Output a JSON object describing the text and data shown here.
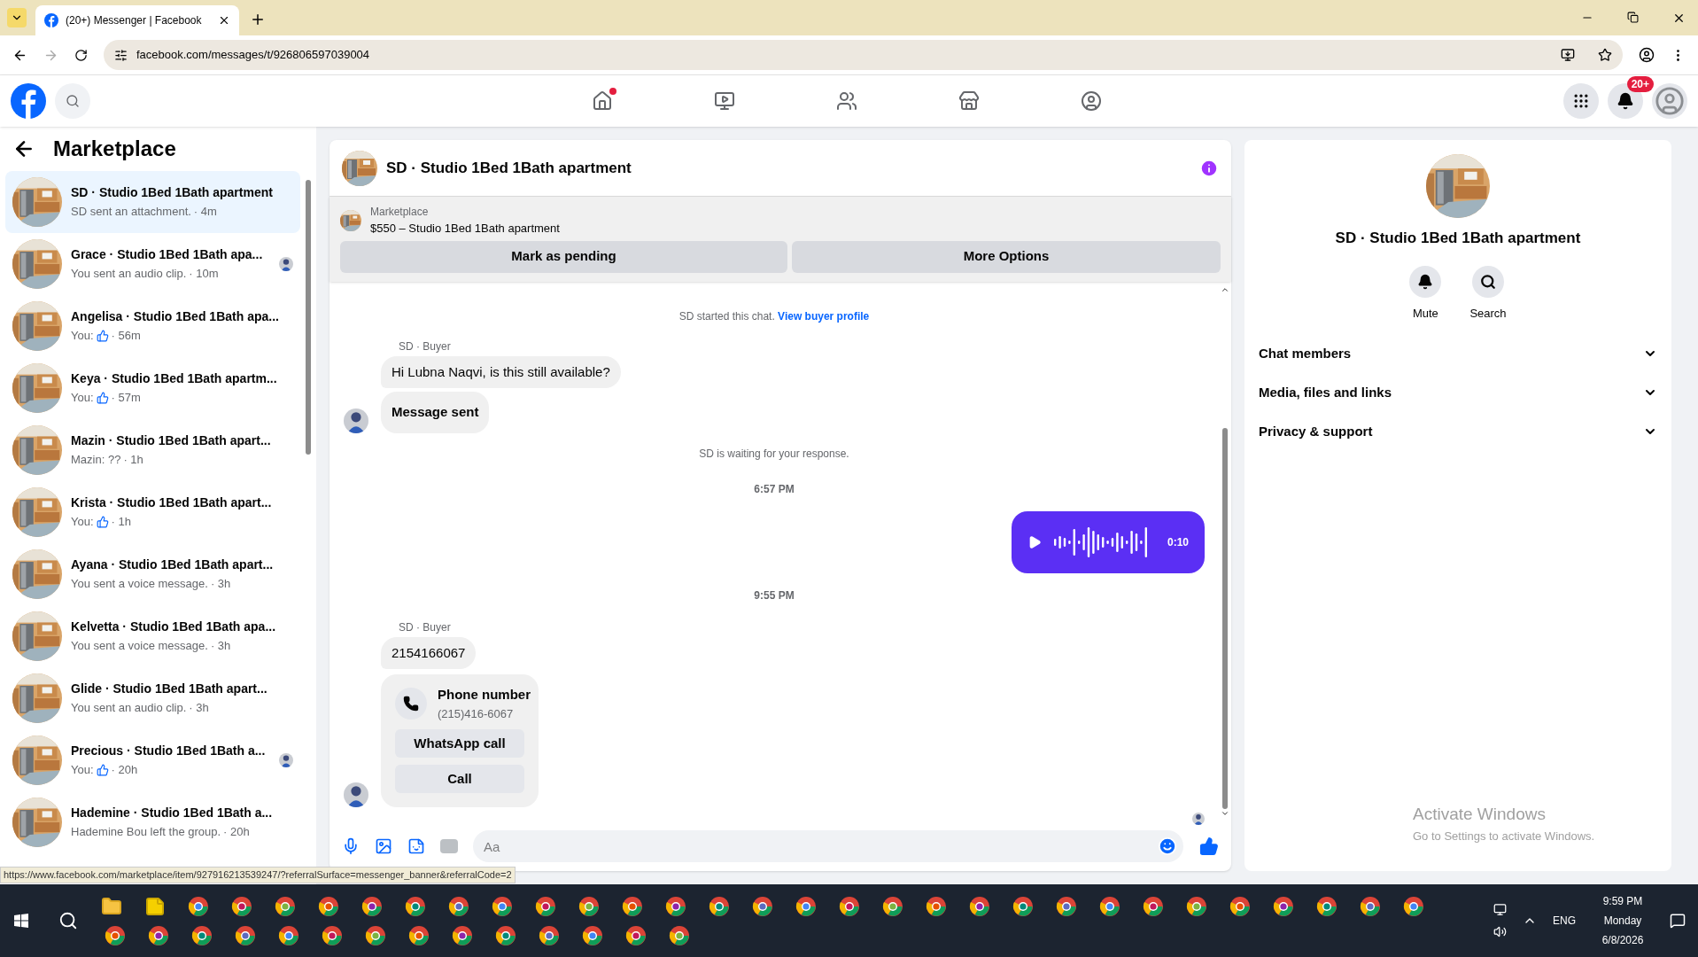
{
  "browser": {
    "tab_title": "(20+) Messenger | Facebook",
    "url": "facebook.com/messages/t/926806597039004"
  },
  "header": {
    "nav": [
      {
        "kind": "home",
        "selected": false,
        "notify": true
      },
      {
        "kind": "video",
        "selected": false,
        "notify": false
      },
      {
        "kind": "friends",
        "selected": false,
        "notify": false
      },
      {
        "kind": "marketplace",
        "selected": false,
        "notify": false
      },
      {
        "kind": "groups",
        "selected": false,
        "notify": false
      }
    ],
    "notification_count": "20+"
  },
  "sidebar": {
    "title": "Marketplace",
    "conversations": [
      {
        "name": "SD · Studio 1Bed 1Bath apartment",
        "preview": "SD sent an attachment.",
        "thumb": false,
        "time": "· 4m",
        "selected": true,
        "seen_avatar": false
      },
      {
        "name": "Grace · Studio 1Bed 1Bath apa...",
        "preview": "You sent an audio clip.",
        "thumb": false,
        "time": "· 10m",
        "selected": false,
        "seen_avatar": true
      },
      {
        "name": "Angelisa · Studio 1Bed 1Bath apa...",
        "preview": "You:",
        "thumb": true,
        "time": "· 56m",
        "selected": false,
        "seen_avatar": false
      },
      {
        "name": "Keya · Studio 1Bed 1Bath apartm...",
        "preview": "You:",
        "thumb": true,
        "time": "· 57m",
        "selected": false,
        "seen_avatar": false
      },
      {
        "name": "Mazin · Studio 1Bed 1Bath apart...",
        "preview": "Mazin: ??",
        "thumb": false,
        "time": "· 1h",
        "selected": false,
        "seen_avatar": false
      },
      {
        "name": "Krista · Studio 1Bed 1Bath apart...",
        "preview": "You:",
        "thumb": true,
        "time": "· 1h",
        "selected": false,
        "seen_avatar": false
      },
      {
        "name": "Ayana · Studio 1Bed 1Bath apart...",
        "preview": "You sent a voice message.",
        "thumb": false,
        "time": "· 3h",
        "selected": false,
        "seen_avatar": false
      },
      {
        "name": "Kelvetta · Studio 1Bed 1Bath apa...",
        "preview": "You sent a voice message.",
        "thumb": false,
        "time": "· 3h",
        "selected": false,
        "seen_avatar": false
      },
      {
        "name": "Glide · Studio 1Bed 1Bath apart...",
        "preview": "You sent an audio clip.",
        "thumb": false,
        "time": "· 3h",
        "selected": false,
        "seen_avatar": false
      },
      {
        "name": "Precious · Studio 1Bed 1Bath a...",
        "preview": "You:",
        "thumb": true,
        "time": "· 20h",
        "selected": false,
        "seen_avatar": true
      },
      {
        "name": "Hademine · Studio 1Bed 1Bath a...",
        "preview": "Hademine Bou left the group.",
        "thumb": false,
        "time": "· 20h",
        "selected": false,
        "seen_avatar": false
      }
    ]
  },
  "chat": {
    "title": "SD · Studio 1Bed 1Bath apartment",
    "listing": {
      "label": "Marketplace",
      "title": "$550 – Studio 1Bed 1Bath apartment"
    },
    "actions": [
      "Mark as pending",
      "More Options"
    ],
    "messages": [
      {
        "kind": "notice",
        "text": "SD started this chat.",
        "link": "View buyer profile"
      },
      {
        "kind": "sender",
        "text": "SD · Buyer"
      },
      {
        "kind": "bubble",
        "text": "Hi Lubna Naqvi, is this still available?",
        "avatar": false
      },
      {
        "kind": "bold_bubble",
        "text": "Message sent",
        "avatar": true
      },
      {
        "kind": "notice",
        "text": "SD is waiting for your response."
      },
      {
        "kind": "time",
        "text": "6:57 PM"
      },
      {
        "kind": "voice",
        "text": "0:10"
      },
      {
        "kind": "time",
        "text": "9:55 PM"
      },
      {
        "kind": "sender",
        "text": "SD · Buyer"
      },
      {
        "kind": "bubble",
        "text": "2154166067",
        "avatar": false
      },
      {
        "kind": "phone",
        "title": "Phone number",
        "text": "(215)416-6067",
        "buttons": [
          "WhatsApp call",
          "Call"
        ],
        "avatar": true
      }
    ],
    "composer": {
      "placeholder": "Aa"
    }
  },
  "details": {
    "title": "SD · Studio 1Bed 1Bath apartment",
    "actions": [
      {
        "kind": "bell",
        "label": "Mute"
      },
      {
        "kind": "search",
        "label": "Search"
      }
    ],
    "sections": [
      {
        "label": "Chat members",
        "expanded": false
      },
      {
        "label": "Media, files and links",
        "expanded": false
      },
      {
        "label": "Privacy & support",
        "expanded": false
      }
    ]
  },
  "activation": {
    "title": "Activate Windows",
    "text": "Go to Settings to activate Windows."
  },
  "status_url": "https://www.facebook.com/marketplace/item/927916213539247/?referralSurface=messenger_banner&referralCode=2",
  "taskbar": {
    "language": "ENG",
    "time": "9:59 PM",
    "day": "Monday",
    "date": "6/8/2026"
  }
}
